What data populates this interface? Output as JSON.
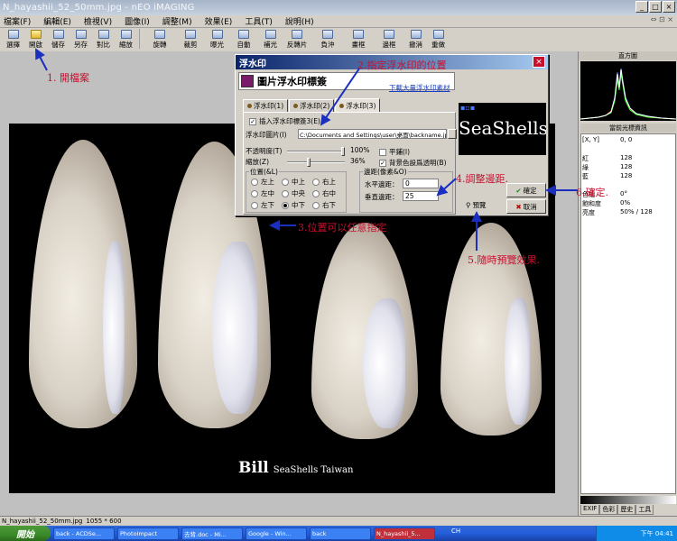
{
  "window": {
    "title": "N_hayashii_52_50mm.jpg - nEO iMAGING",
    "buttons": [
      "_",
      "□",
      "×"
    ]
  },
  "menubar": {
    "items": [
      "檔案(F)",
      "編輯(E)",
      "檢視(V)",
      "圖像(I)",
      "調整(M)",
      "效果(E)",
      "工具(T)",
      "說明(H)"
    ],
    "right": "⇔ ⊡ ×"
  },
  "toolbar": {
    "buttons": [
      "選擇",
      "開啟",
      "儲存",
      "另存",
      "對比",
      "縮放",
      "旋轉",
      "裁剪",
      "曝光",
      "自動",
      "補光",
      "反轉片",
      "負沖",
      "畫框",
      "邊框",
      "撤消",
      "重做"
    ]
  },
  "photo": {
    "watermark_name": "Bill",
    "watermark_text": "SeaShells Taiwan"
  },
  "dialog": {
    "title": "浮水印",
    "close": "×",
    "header": "圖片浮水印標簽",
    "download_link": "下載大量浮水印素材",
    "preview_text": "SeaShells",
    "preview_dots": "▪▫▪",
    "tabs": [
      "浮水印(1)",
      "浮水印(2)",
      "浮水印(3)"
    ],
    "insert_checkbox": "插入浮水印標簽3(E)",
    "image_label": "浮水印圖片(I)",
    "image_path": "C:\\Documents and Settings\\user\\桌面\\backname.jpg",
    "opacity_label": "不透明度(T)",
    "opacity_value": "100%",
    "opacity_level": 1.0,
    "scale_label": "縮放(Z)",
    "scale_value": "36%",
    "scale_level": 0.36,
    "tile_checkbox": "平鋪(I)",
    "bg_transparent_checkbox": "背景色設爲透明(B)",
    "position_group": "位置(&L)",
    "positions": [
      "左上",
      "中上",
      "右上",
      "左中",
      "中央",
      "右中",
      "左下",
      "中下",
      "右下"
    ],
    "selected_position": "中下",
    "margin_group": "邊距(像素&O)",
    "h_margin_label": "水平邊距：",
    "h_margin_value": "0",
    "v_margin_label": "垂直邊距：",
    "v_margin_value": "25",
    "ok": "確定",
    "cancel": "取消",
    "preview_button": "預覽"
  },
  "right_panel": {
    "histogram_title": "直方圖",
    "info_title": "當前光標資訊",
    "rows": [
      {
        "k": "[X, Y]",
        "v": "0, 0"
      },
      {
        "k": "",
        "v": ""
      },
      {
        "k": "紅",
        "v": "128"
      },
      {
        "k": "綠",
        "v": "128"
      },
      {
        "k": "藍",
        "v": "128"
      },
      {
        "k": "",
        "v": ""
      },
      {
        "k": "色相",
        "v": "0°"
      },
      {
        "k": "飽和度",
        "v": "0%"
      },
      {
        "k": "亮度",
        "v": "50% / 128"
      }
    ],
    "tabs": [
      "EXIF",
      "色彩",
      "歷史",
      "工具"
    ]
  },
  "statusbar": {
    "filename": "N_hayashii_52_50mm.jpg",
    "size": "1055 * 600"
  },
  "taskbar": {
    "start": "開始",
    "tasks": [
      "back - ACDSe...",
      "PhotoImpact",
      "去背.doc - Mi...",
      "Google - Win...",
      "back",
      "N_hayashii_5..."
    ],
    "tray_lang": "CH",
    "clock": "下午 04:41"
  },
  "annotations": [
    "1. 開檔案",
    "2.指定浮水印的位置",
    "3.位置可以任意指定",
    "4.調整邊距.",
    "5.隨時預覽效果.",
    "6.確定."
  ],
  "colors": {
    "annotation": "#c8102e",
    "arrow": "#1a2fbf",
    "dialog_title": "#0a246a"
  }
}
